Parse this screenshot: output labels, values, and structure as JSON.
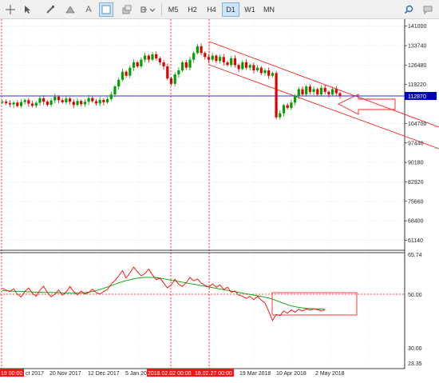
{
  "toolbar": {
    "tools": [
      "crosshair-icon",
      "cursor-icon",
      "pen-line-icon",
      "triangle-icon",
      "grid-icon",
      "text-icon",
      "shapes-icon"
    ],
    "timeframes": [
      "M5",
      "H2",
      "H4",
      "D1",
      "W1",
      "MN"
    ],
    "active_timeframe": "D1"
  },
  "price_axis": {
    "labels": [
      "141000",
      "133740",
      "126480",
      "119220",
      "112870",
      "104700",
      "97440",
      "90180",
      "82920",
      "75660",
      "68400",
      "61140"
    ],
    "current_price": "112870"
  },
  "indicator_axis": {
    "labels": [
      "65.74",
      "50.00",
      "30.00",
      "23.35"
    ]
  },
  "time_axis": {
    "labels": [
      "ct 2017",
      "20 Nov 2017",
      "12 Dec 2017",
      "5 Jan 20",
      "19 Mar 2018",
      "10 Apr 2018",
      "2 May 2018"
    ],
    "left_badge": "19 00:00",
    "marker_badges": [
      "2018.02.02 00:00",
      "18.02.27 00:00"
    ]
  },
  "colors": {
    "bull": "#00a000",
    "bear": "#e00000",
    "current_line": "#3030e0",
    "channel": "#ff2020",
    "rsi": "#ff0000",
    "ma": "#00a000"
  },
  "chart_data": {
    "type": "candlestick",
    "price_range": [
      58000,
      143000
    ],
    "current_price": 112870,
    "candles_close": [
      112870,
      112300,
      111800,
      112500,
      111200,
      112700,
      113400,
      112100,
      111300,
      112400,
      114100,
      112800,
      111700,
      113300,
      114700,
      113400,
      112600,
      114000,
      112800,
      111600,
      113100,
      111900,
      112800,
      114200,
      113000,
      112200,
      113500,
      112600,
      113800,
      115500,
      118500,
      121000,
      124000,
      122500,
      125500,
      127500,
      126000,
      128500,
      130000,
      128500,
      130500,
      129000,
      127500,
      126000,
      121500,
      119500,
      123000,
      124500,
      127500,
      125500,
      128500,
      131000,
      133500,
      131000,
      129500,
      128500,
      130000,
      128000,
      129500,
      127500,
      126500,
      129000,
      126500,
      125000,
      127500,
      125500,
      126500,
      124500,
      125500,
      123500,
      124500,
      122500,
      123500,
      107000,
      108500,
      111500,
      110500,
      112500,
      115000,
      117500,
      115500,
      118500,
      116500,
      117500,
      115500,
      118000,
      116500,
      115500,
      117500,
      116000,
      115000
    ],
    "indicator": {
      "range": [
        20,
        70
      ],
      "levels": [
        65.74,
        50.0,
        30.0,
        23.35
      ],
      "rsi": [
        55.0,
        54.2,
        53.6,
        54.8,
        52.4,
        51.2,
        53.6,
        55.2,
        52.8,
        51.5,
        54.2,
        55.9,
        53.1,
        51.3,
        52.4,
        54.3,
        52.0,
        53.4,
        55.8,
        53.6,
        52.1,
        53.8,
        52.5,
        53.1,
        54.6,
        53.1,
        52.5,
        53.6,
        54.5,
        56.9,
        58.4,
        60.5,
        62.8,
        59.5,
        61.8,
        64.3,
        62.3,
        60.5,
        61.5,
        63.5,
        61.0,
        58.8,
        59.5,
        57.3,
        55.2,
        56.5,
        59.0,
        56.8,
        55.8,
        57.5,
        59.8,
        58.3,
        59.1,
        57.3,
        56.3,
        55.5,
        57.0,
        55.5,
        56.5,
        54.5,
        55.5,
        53.3,
        53.8,
        52.0,
        51.5,
        50.6,
        51.4,
        50.0,
        51.5,
        49.8,
        48.6,
        44.8,
        40.8,
        43.5,
        43.0,
        45.0,
        44.0,
        45.5,
        44.5,
        45.8,
        45.0,
        46.0,
        45.4,
        46.0,
        45.6,
        45.0,
        45.6
      ],
      "ma": [
        54.0,
        53.9,
        53.8,
        53.7,
        53.7,
        53.6,
        53.5,
        53.5,
        53.4,
        53.3,
        53.3,
        53.2,
        53.2,
        53.2,
        53.1,
        53.1,
        53.0,
        53.0,
        53.0,
        53.0,
        53.0,
        53.0,
        53.1,
        53.3,
        53.6,
        54.0,
        54.5,
        55.0,
        55.6,
        56.2,
        56.8,
        57.4,
        57.9,
        58.4,
        58.8,
        59.2,
        59.5,
        59.7,
        59.8,
        59.8,
        59.8,
        59.7,
        59.5,
        59.2,
        58.9,
        58.6,
        58.3,
        58.0,
        57.7,
        57.4,
        57.1,
        56.8,
        56.5,
        56.2,
        55.9,
        55.6,
        55.3,
        55.0,
        54.7,
        54.4,
        54.1,
        53.8,
        53.5,
        53.2,
        52.9,
        52.6,
        52.3,
        52.0,
        51.7,
        51.4,
        51.1,
        50.7,
        50.2,
        49.6,
        49.0,
        48.4,
        47.8,
        47.3,
        46.9,
        46.6,
        46.4,
        46.2,
        46.1,
        46.0,
        45.9,
        45.8,
        45.8
      ]
    }
  }
}
